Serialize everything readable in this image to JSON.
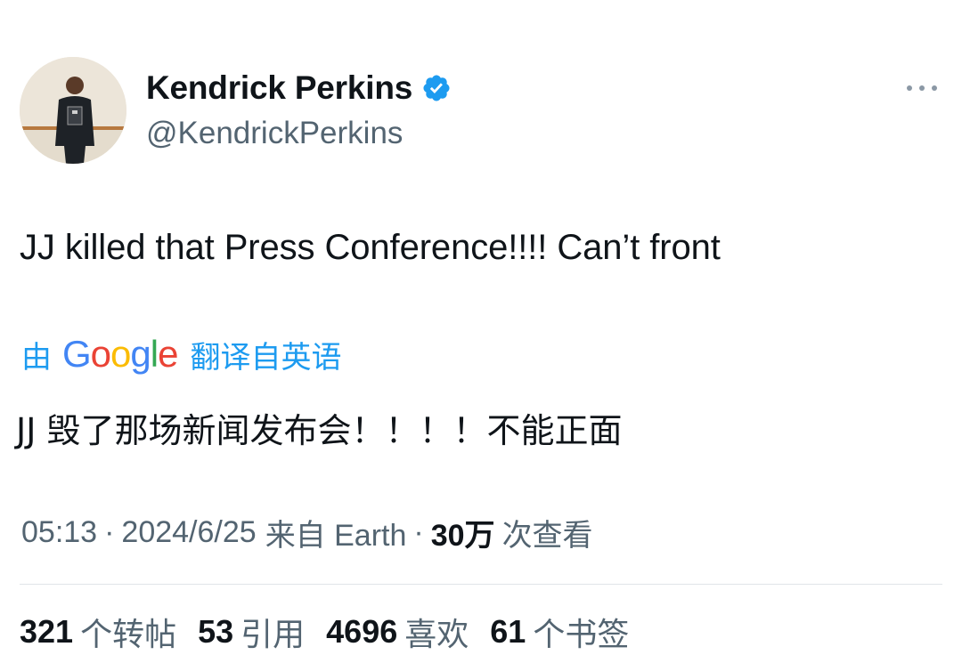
{
  "author": {
    "display_name": "Kendrick Perkins",
    "handle": "@KendrickPerkins",
    "verified": true,
    "avatar_icon": "profile-photo-icon"
  },
  "tweet": {
    "text": "JJ killed that Press Conference!!!! Can’t front"
  },
  "translation": {
    "prefix": "由",
    "provider": "Google",
    "suffix": "翻译自英语",
    "translated_text": "JJ 毁了那场新闻发布会！！！！不能正面"
  },
  "meta": {
    "time": "05:13",
    "separator": "·",
    "date": "2024/6/25",
    "source": "来自 Earth",
    "views_count": "30万",
    "views_label": "次查看"
  },
  "stats": [
    {
      "count": "321",
      "label": "个转帖"
    },
    {
      "count": "53",
      "label": "引用"
    },
    {
      "count": "4696",
      "label": "喜欢"
    },
    {
      "count": "61",
      "label": "个书签"
    }
  ],
  "colors": {
    "accent": "#1d9bf0",
    "text_primary": "#0f1419",
    "text_secondary": "#536471",
    "divider": "#e1e5e8"
  }
}
